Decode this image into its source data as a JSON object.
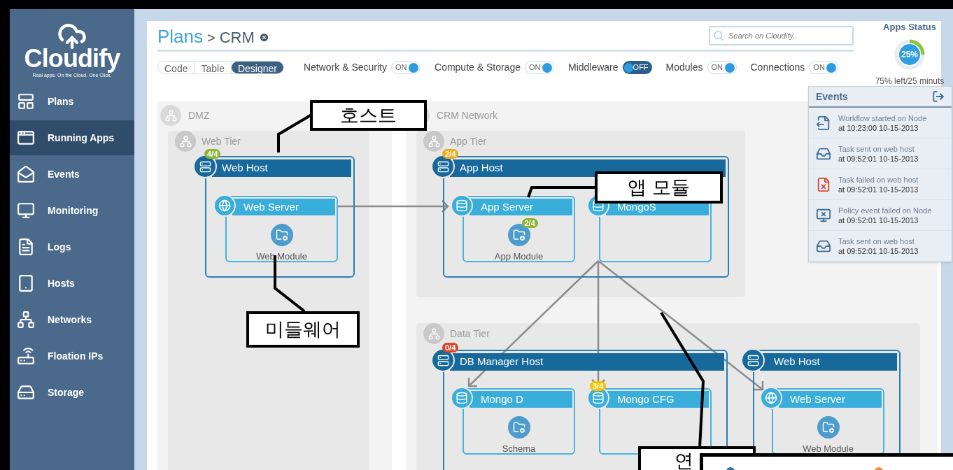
{
  "sidebar": {
    "logo": {
      "name": "Cloudify",
      "tagline": "Real apps. On the Cloud. One Click."
    },
    "items": [
      {
        "label": "Plans",
        "selected": false
      },
      {
        "label": "Running Apps",
        "selected": true
      },
      {
        "label": "Events",
        "selected": false
      },
      {
        "label": "Monitoring",
        "selected": false
      },
      {
        "label": "Logs",
        "selected": false
      },
      {
        "label": "Hosts",
        "selected": false
      },
      {
        "label": "Networks",
        "selected": false
      },
      {
        "label": "Floation IPs",
        "selected": false
      },
      {
        "label": "Storage",
        "selected": false
      }
    ]
  },
  "header": {
    "breadcrumb": {
      "root": "Plans",
      "separator": ">",
      "current": "CRM"
    },
    "search": {
      "placeholder": "Search on Cloudify.."
    },
    "views": [
      {
        "label": "Code",
        "selected": false
      },
      {
        "label": "Table",
        "selected": false
      },
      {
        "label": "Designer",
        "selected": true
      }
    ],
    "toggles": [
      {
        "label": "Network & Security",
        "on": true,
        "state": "ON"
      },
      {
        "label": "Compute & Storage",
        "on": true,
        "state": "ON"
      },
      {
        "label": "Middleware",
        "on": false,
        "state": "OFF"
      },
      {
        "label": "Modules",
        "on": true,
        "state": "ON"
      },
      {
        "label": "Connections",
        "on": true,
        "state": "ON"
      }
    ]
  },
  "apps_status": {
    "title": "Apps Status",
    "percent": "25%",
    "level": 0.25,
    "caption": "75% left/25 minuts"
  },
  "events": {
    "title": "Events",
    "items": [
      {
        "title": "Workflow started on Node",
        "time": "at 10:23:00 10-15-2013"
      },
      {
        "title": "Task sent on web host",
        "time": "at 09:52:01 10-15-2013"
      },
      {
        "title": "Task failed on web host",
        "time": "at 09:52:01 10-15-2013"
      },
      {
        "title": "Policy event failed on Node",
        "time": "at 09:52:01 10-15-2013"
      },
      {
        "title": "Task sent on web host",
        "time": "at 09:52:01 10-15-2013"
      }
    ]
  },
  "diagram": {
    "networks": [
      {
        "label": "DMZ"
      },
      {
        "label": "CRM Network"
      }
    ],
    "tiers": [
      {
        "label": "Web Tier"
      },
      {
        "label": "App Tier"
      },
      {
        "label": "Data Tier"
      }
    ],
    "hosts": [
      {
        "label": "Web Host",
        "badge": {
          "text": "4/4",
          "color": "#8bb534"
        },
        "services": [
          {
            "label": "Web Server",
            "kind": "web",
            "modules": [
              {
                "label": "Web Module"
              }
            ]
          }
        ]
      },
      {
        "label": "App Host",
        "badge": {
          "text": "2/4",
          "color": "#f2a91a"
        },
        "services": [
          {
            "label": "App Server",
            "kind": "db",
            "modules": [
              {
                "label": "App Module",
                "badge": {
                  "text": "2/4",
                  "color": "#8bb534"
                }
              }
            ]
          },
          {
            "label": "MongoS",
            "kind": "db"
          }
        ]
      },
      {
        "label": "DB Manager Host",
        "badge": {
          "text": "0/4",
          "color": "#d9472f"
        },
        "services": [
          {
            "label": "Mongo D",
            "kind": "db",
            "modules": [
              {
                "label": "Schema"
              }
            ]
          },
          {
            "label": "Mongo CFG",
            "kind": "db",
            "badge": {
              "text": "3/4",
              "color": "#f5c400"
            }
          }
        ]
      },
      {
        "label": "Web Host",
        "services": [
          {
            "label": "Web Server",
            "kind": "web",
            "modules": [
              {
                "label": "Web Module"
              }
            ]
          }
        ]
      }
    ],
    "callouts": [
      {
        "text": "호스트"
      },
      {
        "text": "앱 모듈"
      },
      {
        "text": "미들웨어"
      },
      {
        "text": "연"
      }
    ]
  }
}
